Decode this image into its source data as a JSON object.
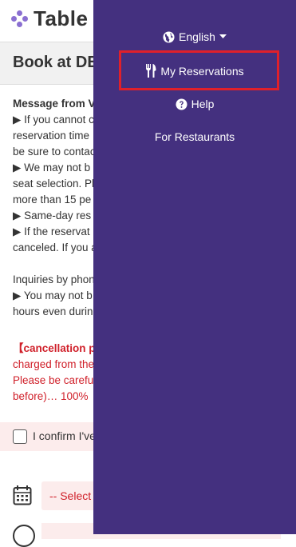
{
  "header": {
    "logo_text": "Table"
  },
  "booking": {
    "title": "Book at DE"
  },
  "message": {
    "lines": [
      "Message from V",
      "▶ If you cannot c",
      "reservation time",
      "be sure to contac",
      "▶ We may not b",
      "seat selection. Pl",
      "more than 15 pe",
      "▶ Same-day res",
      "▶ If the reservat",
      "canceled. If you a",
      "",
      "Inquiries by phon",
      "▶ You may not b",
      "hours even durin"
    ]
  },
  "cancellation": {
    "lines": [
      "【cancellation p",
      "charged from the",
      "Please be carefu",
      "before)… 100%"
    ]
  },
  "confirm": {
    "label": "I confirm I've"
  },
  "date": {
    "placeholder": "-- Select D"
  },
  "menu": {
    "language": "English",
    "my_reservations": "My Reservations",
    "help": "Help",
    "for_restaurants": "For Restaurants"
  },
  "colors": {
    "menu_bg": "#44307f",
    "highlight": "#e0202a",
    "alert_red": "#d0202a"
  }
}
